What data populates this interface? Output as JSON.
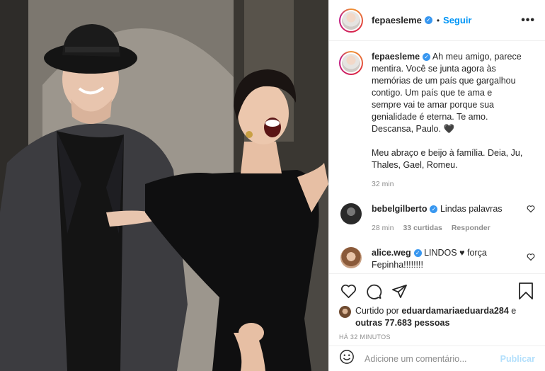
{
  "post": {
    "author": {
      "username": "fepaesleme",
      "verified": true,
      "follow_label": "Seguir",
      "separator": "•",
      "more_icon": "more-horizontal-icon"
    },
    "caption": {
      "username": "fepaesleme",
      "text": "Ah meu amigo, parece mentira. Você se junta agora às memórias de um país que gargalhou contigo. Um país que te ama e sempre vai te amar porque sua genialidade é eterna. Te amo. Descansa, Paulo. 🖤\n\nMeu abraço e beijo à família. Deia, Ju, Thales, Gael, Romeu.",
      "time": "32 min"
    },
    "comments": [
      {
        "username": "bebelgilberto",
        "text": "Lindas palavras",
        "time": "28 min",
        "likes": "33 curtidas",
        "reply_label": "Responder"
      },
      {
        "username": "alice.weg",
        "text": "LINDOS ♥ força Fepinha!!!!!!!!"
      }
    ],
    "actions": {
      "like_icon": "heart-icon",
      "comment_icon": "comment-icon",
      "share_icon": "share-icon",
      "save_icon": "bookmark-icon"
    },
    "likes": {
      "prefix": "Curtido por ",
      "user": "eduardamariaeduarda284",
      "middle": " e ",
      "others": "outras 77.683 pessoas"
    },
    "time_ago": "HÁ 32 MINUTOS",
    "add_comment": {
      "placeholder": "Adicione um comentário...",
      "publish_label": "Publicar",
      "emoji_icon": "emoji-icon"
    },
    "colors": {
      "link": "#0095f6",
      "verified": "#3897f0",
      "publish_disabled": "#b2dffc"
    }
  }
}
